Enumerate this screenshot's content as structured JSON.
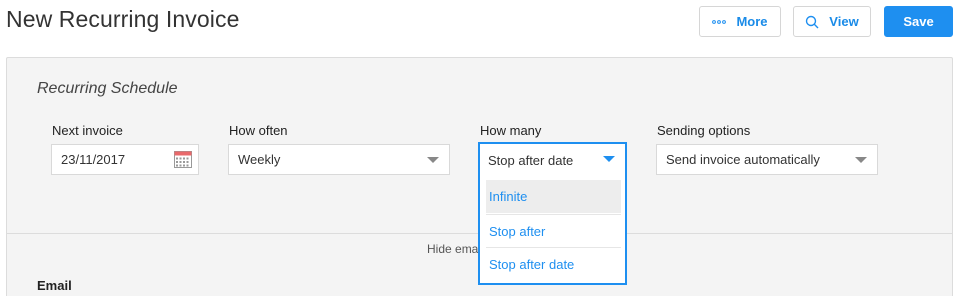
{
  "header": {
    "title": "New Recurring Invoice",
    "more_label": "More",
    "view_label": "View",
    "save_label": "Save"
  },
  "schedule": {
    "section_title": "Recurring Schedule",
    "next_invoice": {
      "label": "Next invoice",
      "value": "23/11/2017"
    },
    "how_often": {
      "label": "How often",
      "value": "Weekly"
    },
    "how_many": {
      "label": "How many",
      "value": "Stop after date",
      "options": [
        "Infinite",
        "Stop after",
        "Stop after date"
      ]
    },
    "sending_options": {
      "label": "Sending options",
      "value": "Send invoice automatically"
    }
  },
  "hide_email_link": "Hide ema",
  "email_section_label": "Email",
  "colors": {
    "accent": "#1e8ff0",
    "panel_bg": "#f4f4f4",
    "highlight_row": "#ededed"
  },
  "icons": {
    "more": "dots-icon",
    "view": "search-icon",
    "calendar": "calendar-icon",
    "caret": "chevron-down-icon"
  }
}
